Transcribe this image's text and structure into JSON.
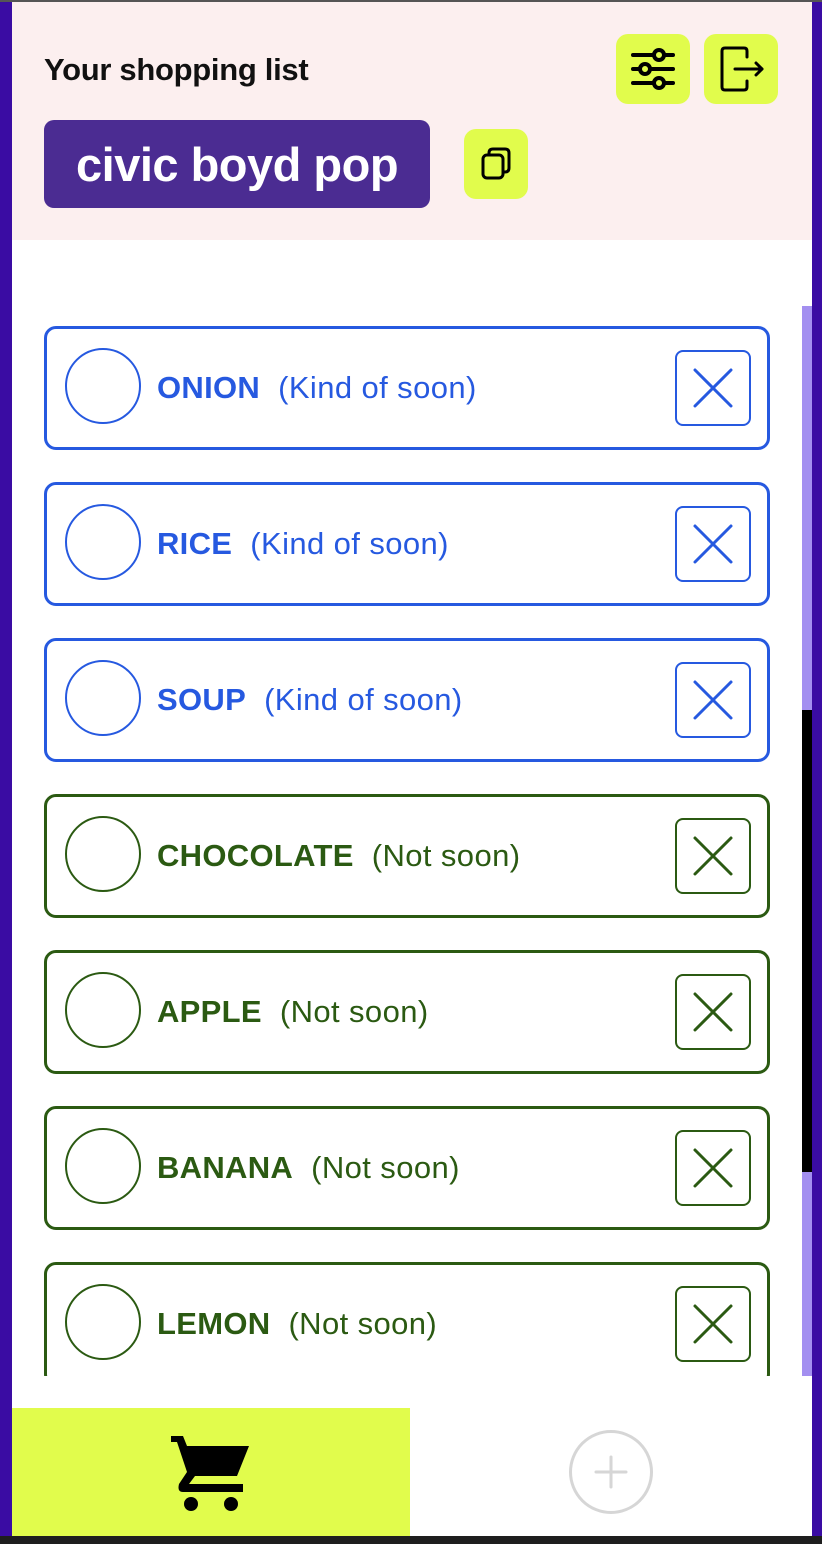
{
  "header": {
    "title": "Your shopping list",
    "token": "civic boyd pop",
    "settings_icon": "sliders-icon",
    "logout_icon": "logout-icon",
    "copy_icon": "copy-icon"
  },
  "items": [
    {
      "name": "ONION",
      "urgency": "(Kind of soon)",
      "group": "soon"
    },
    {
      "name": "RICE",
      "urgency": "(Kind of soon)",
      "group": "soon"
    },
    {
      "name": "SOUP",
      "urgency": "(Kind of soon)",
      "group": "soon"
    },
    {
      "name": "CHOCOLATE",
      "urgency": "(Not soon)",
      "group": "notsoon"
    },
    {
      "name": "APPLE",
      "urgency": "(Not soon)",
      "group": "notsoon"
    },
    {
      "name": "BANANA",
      "urgency": "(Not soon)",
      "group": "notsoon"
    },
    {
      "name": "LEMON",
      "urgency": "(Not soon)",
      "group": "notsoon"
    }
  ],
  "nav": {
    "list_icon": "cart-icon",
    "add_icon": "plus-circle-icon"
  },
  "colors": {
    "accent": "#e1fc4c",
    "token_bg": "#4b2c92",
    "header_bg": "#fcefef",
    "soon": "#2659e0",
    "not_soon": "#2b5a12",
    "frame": "#3a0ca3"
  }
}
